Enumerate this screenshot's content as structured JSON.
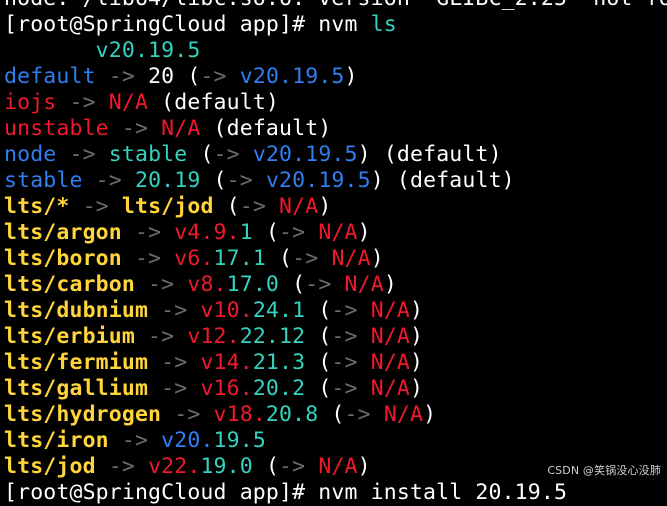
{
  "colors": {
    "background": "#000000",
    "fg": "#ffffff",
    "blue": "#2f7ff0",
    "cyan": "#34d2c0",
    "red": "#f0182c",
    "yellow": "#ffd53a",
    "dim": "#6c6c6c"
  },
  "terminal": {
    "lines": [
      [
        [
          "fg",
          "node: /lib64/libc.so.6: version `GLIBC_2.25' not fo"
        ]
      ],
      [
        [
          "fg",
          "[root@SpringCloud app]# nvm "
        ],
        [
          "cyan",
          "ls"
        ]
      ],
      [
        [
          "fg",
          "       "
        ],
        [
          "cyan",
          "v20.19.5"
        ]
      ],
      [
        [
          "blue",
          "default"
        ],
        [
          "dim",
          " -> "
        ],
        [
          "fg",
          "20 ("
        ],
        [
          "dim",
          "-> "
        ],
        [
          "blue",
          "v20.19.5"
        ],
        [
          "fg",
          ")"
        ]
      ],
      [
        [
          "red",
          "iojs"
        ],
        [
          "dim",
          " -> "
        ],
        [
          "red",
          "N/A"
        ],
        [
          "fg",
          " (default)"
        ]
      ],
      [
        [
          "red",
          "unstable"
        ],
        [
          "dim",
          " -> "
        ],
        [
          "red",
          "N/A"
        ],
        [
          "fg",
          " (default)"
        ]
      ],
      [
        [
          "blue",
          "node"
        ],
        [
          "dim",
          " -> "
        ],
        [
          "cyan",
          "stable"
        ],
        [
          "fg",
          " ("
        ],
        [
          "dim",
          "-> "
        ],
        [
          "blue",
          "v20.19.5"
        ],
        [
          "fg",
          ") (default)"
        ]
      ],
      [
        [
          "blue",
          "stable"
        ],
        [
          "dim",
          " -> "
        ],
        [
          "cyan",
          "20.19"
        ],
        [
          "fg",
          " ("
        ],
        [
          "dim",
          "-> "
        ],
        [
          "blue",
          "v20.19.5"
        ],
        [
          "fg",
          ") (default)"
        ]
      ],
      [
        [
          "yellow",
          "lts/*"
        ],
        [
          "dim",
          " -> "
        ],
        [
          "yellow",
          "lts/jod"
        ],
        [
          "fg",
          " ("
        ],
        [
          "dim",
          "-> "
        ],
        [
          "red",
          "N/A"
        ],
        [
          "fg",
          ")"
        ]
      ],
      [
        [
          "yellow",
          "lts/argon"
        ],
        [
          "dim",
          " -> "
        ],
        [
          "red",
          "v4.9."
        ],
        [
          "cyan",
          "1"
        ],
        [
          "fg",
          " ("
        ],
        [
          "dim",
          "-> "
        ],
        [
          "red",
          "N/A"
        ],
        [
          "fg",
          ")"
        ]
      ],
      [
        [
          "yellow",
          "lts/boron"
        ],
        [
          "dim",
          " -> "
        ],
        [
          "red",
          "v6."
        ],
        [
          "cyan",
          "17.1"
        ],
        [
          "fg",
          " ("
        ],
        [
          "dim",
          "-> "
        ],
        [
          "red",
          "N/A"
        ],
        [
          "fg",
          ")"
        ]
      ],
      [
        [
          "yellow",
          "lts/carbon"
        ],
        [
          "dim",
          " -> "
        ],
        [
          "red",
          "v8."
        ],
        [
          "cyan",
          "17.0"
        ],
        [
          "fg",
          " ("
        ],
        [
          "dim",
          "-> "
        ],
        [
          "red",
          "N/A"
        ],
        [
          "fg",
          ")"
        ]
      ],
      [
        [
          "yellow",
          "lts/dubnium"
        ],
        [
          "dim",
          " -> "
        ],
        [
          "red",
          "v10."
        ],
        [
          "cyan",
          "24.1"
        ],
        [
          "fg",
          " ("
        ],
        [
          "dim",
          "-> "
        ],
        [
          "red",
          "N/A"
        ],
        [
          "fg",
          ")"
        ]
      ],
      [
        [
          "yellow",
          "lts/erbium"
        ],
        [
          "dim",
          " -> "
        ],
        [
          "red",
          "v12."
        ],
        [
          "cyan",
          "22.12"
        ],
        [
          "fg",
          " ("
        ],
        [
          "dim",
          "-> "
        ],
        [
          "red",
          "N/A"
        ],
        [
          "fg",
          ")"
        ]
      ],
      [
        [
          "yellow",
          "lts/fermium"
        ],
        [
          "dim",
          " -> "
        ],
        [
          "red",
          "v14."
        ],
        [
          "cyan",
          "21.3"
        ],
        [
          "fg",
          " ("
        ],
        [
          "dim",
          "-> "
        ],
        [
          "red",
          "N/A"
        ],
        [
          "fg",
          ")"
        ]
      ],
      [
        [
          "yellow",
          "lts/gallium"
        ],
        [
          "dim",
          " -> "
        ],
        [
          "red",
          "v16."
        ],
        [
          "cyan",
          "20.2"
        ],
        [
          "fg",
          " ("
        ],
        [
          "dim",
          "-> "
        ],
        [
          "red",
          "N/A"
        ],
        [
          "fg",
          ")"
        ]
      ],
      [
        [
          "yellow",
          "lts/hydrogen"
        ],
        [
          "dim",
          " -> "
        ],
        [
          "red",
          "v18."
        ],
        [
          "cyan",
          "20.8"
        ],
        [
          "fg",
          " ("
        ],
        [
          "dim",
          "-> "
        ],
        [
          "red",
          "N/A"
        ],
        [
          "fg",
          ")"
        ]
      ],
      [
        [
          "yellow",
          "lts/iron"
        ],
        [
          "dim",
          " -> "
        ],
        [
          "blue",
          "v20."
        ],
        [
          "cyan",
          "19.5"
        ]
      ],
      [
        [
          "yellow",
          "lts/jod"
        ],
        [
          "dim",
          " -> "
        ],
        [
          "red",
          "v22."
        ],
        [
          "cyan",
          "19.0"
        ],
        [
          "fg",
          " ("
        ],
        [
          "dim",
          "-> "
        ],
        [
          "red",
          "N/A"
        ],
        [
          "fg",
          ")"
        ]
      ],
      [
        [
          "fg",
          "[root@SpringCloud app]# nvm install 20.19.5"
        ]
      ]
    ]
  },
  "watermark": {
    "text": "CSDN @笑锅没心没肺"
  }
}
